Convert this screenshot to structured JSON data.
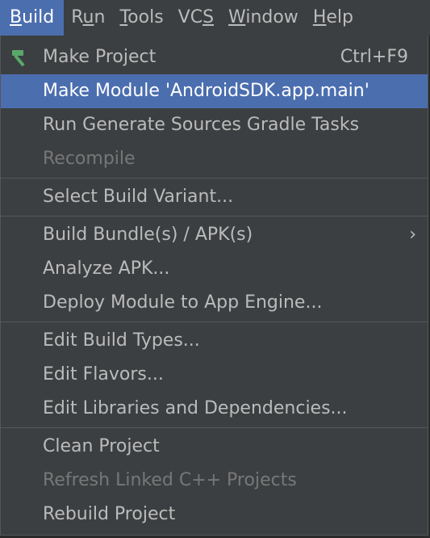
{
  "menubar": {
    "items": [
      {
        "label": "Build",
        "mnemonic": "B"
      },
      {
        "label": "Run",
        "mnemonic": "u"
      },
      {
        "label": "Tools",
        "mnemonic": "T"
      },
      {
        "label": "VCS",
        "mnemonic": "S"
      },
      {
        "label": "Window",
        "mnemonic": "W"
      },
      {
        "label": "Help",
        "mnemonic": "H"
      }
    ],
    "active": "Build"
  },
  "build_menu": {
    "make_project": {
      "label": "Make Project",
      "shortcut": "Ctrl+F9",
      "icon": "hammer-icon"
    },
    "make_module": {
      "label": "Make Module 'AndroidSDK.app.main'"
    },
    "run_generate": {
      "label": "Run Generate Sources Gradle Tasks"
    },
    "recompile": {
      "label": "Recompile",
      "disabled": true
    },
    "select_variant": {
      "label": "Select Build Variant..."
    },
    "build_bundle": {
      "label": "Build Bundle(s) / APK(s)",
      "submenu_icon": "chevron-right-icon",
      "submenu_glyph": "›"
    },
    "analyze_apk": {
      "label": "Analyze APK..."
    },
    "deploy_module": {
      "label": "Deploy Module to App Engine..."
    },
    "edit_build_types": {
      "label": "Edit Build Types..."
    },
    "edit_flavors": {
      "label": "Edit Flavors..."
    },
    "edit_libraries": {
      "label": "Edit Libraries and Dependencies..."
    },
    "clean_project": {
      "label": "Clean Project"
    },
    "refresh_cpp": {
      "label": "Refresh Linked C++ Projects",
      "disabled": true
    },
    "rebuild_project": {
      "label": "Rebuild Project"
    }
  },
  "colors": {
    "menu_bg": "#3c3f41",
    "selection": "#4b6eaf",
    "text": "#bbbbbb",
    "disabled_text": "#777777",
    "hammer_icon": "#59a869"
  }
}
